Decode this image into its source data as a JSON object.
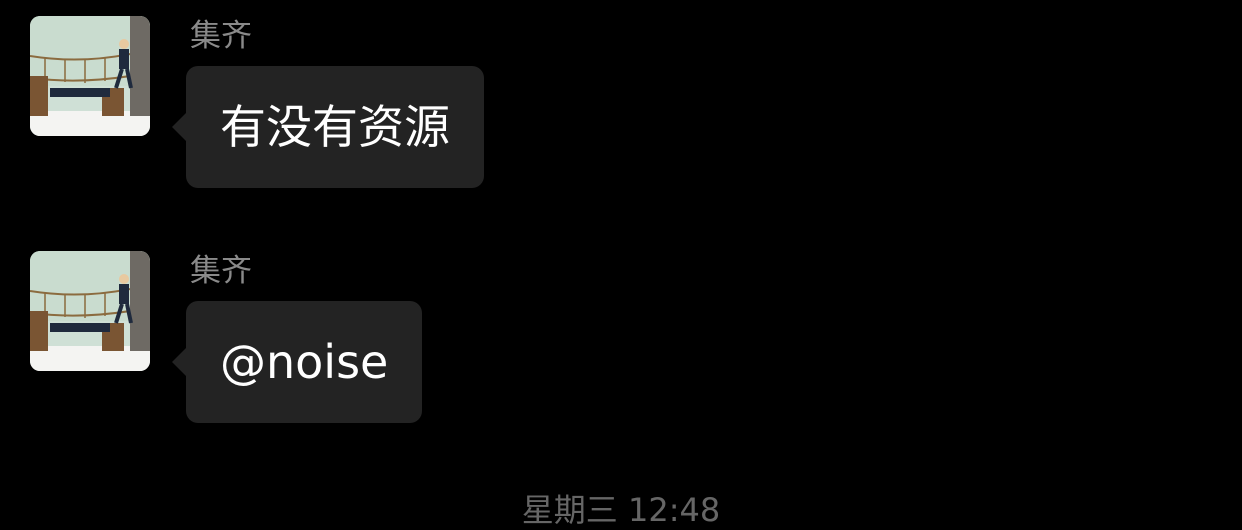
{
  "messages": [
    {
      "sender": "集齐",
      "text": "有没有资源",
      "avatar_icon": "user-avatar-bridge-icon"
    },
    {
      "sender": "集齐",
      "text": "@noise",
      "avatar_icon": "user-avatar-bridge-icon"
    }
  ],
  "timestamp": "星期三 12:48",
  "colors": {
    "background": "#000000",
    "bubble": "#232323",
    "bubble_text": "#ffffff",
    "sender_name": "#8a8a8a",
    "timestamp": "#666666"
  }
}
